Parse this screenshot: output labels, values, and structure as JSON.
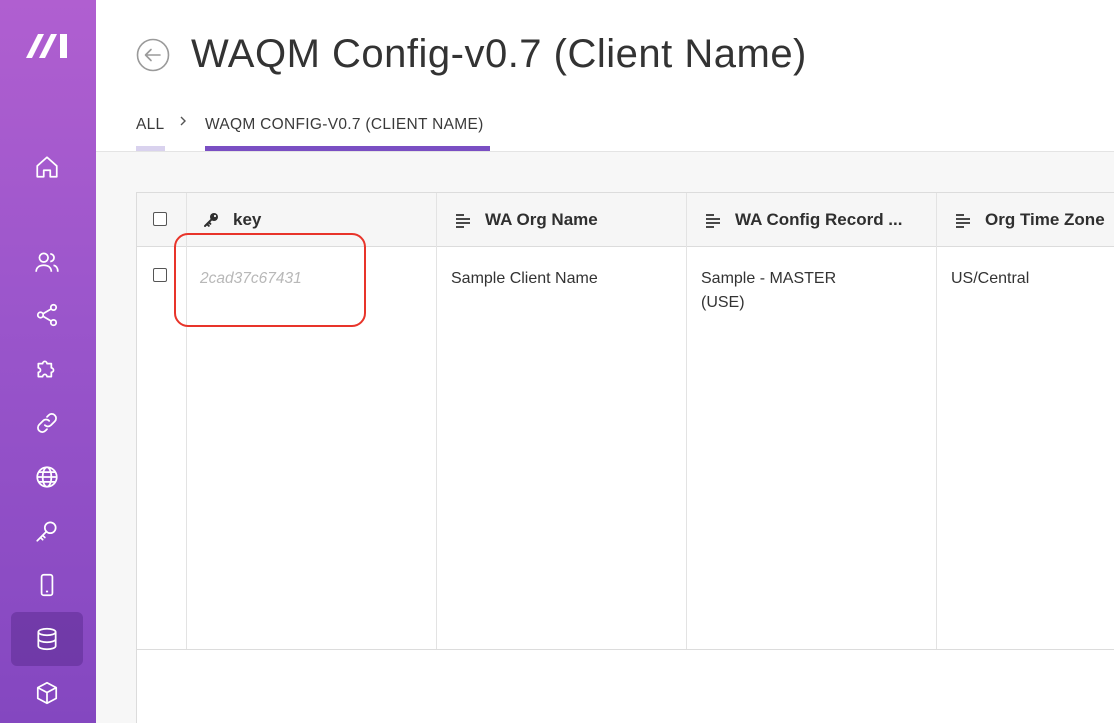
{
  "page": {
    "title": "WAQM Config-v0.7 (Client Name)"
  },
  "breadcrumb": {
    "all": "ALL",
    "current": "WAQM CONFIG-V0.7 (CLIENT NAME)"
  },
  "sidebar": {
    "items": [
      {
        "icon": "home-icon"
      },
      {
        "icon": "users-icon"
      },
      {
        "icon": "share-icon"
      },
      {
        "icon": "puzzle-icon"
      },
      {
        "icon": "link-icon"
      },
      {
        "icon": "globe-icon"
      },
      {
        "icon": "key-icon"
      },
      {
        "icon": "mobile-icon"
      },
      {
        "icon": "database-icon",
        "active": true
      },
      {
        "icon": "box-icon"
      }
    ]
  },
  "table": {
    "columns": [
      {
        "label": "key",
        "icon": "key-icon"
      },
      {
        "label": "WA Org Name",
        "icon": "text-align-icon"
      },
      {
        "label": "WA Config Record ...",
        "icon": "text-align-icon"
      },
      {
        "label": "Org Time Zone",
        "icon": "text-align-icon"
      }
    ],
    "rows": [
      {
        "key": "2cad37c67431",
        "wa_org_name": "Sample Client Name",
        "wa_config_record_line1": "Sample - MASTER",
        "wa_config_record_line2": "(USE)",
        "org_time_zone": "US/Central"
      }
    ]
  },
  "colors": {
    "sidebar_top": "#b05fd0",
    "sidebar_bottom": "#8447c0",
    "accent": "#7a4fc3",
    "highlight": "#e8342a"
  }
}
